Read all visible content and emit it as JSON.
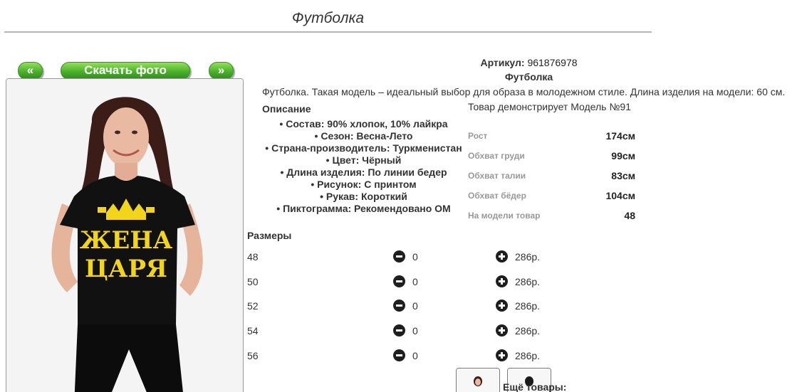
{
  "page": {
    "title": "Футболка"
  },
  "gallery": {
    "prev_label": "«",
    "download_label": "Скачать фото",
    "next_label": "»",
    "print_text_line1": "ЖЕНА",
    "print_text_line2": "ЦАРЯ"
  },
  "product": {
    "article_label": "Артикул:",
    "article_value": "961876978",
    "name": "Футболка",
    "description": "Футболка. Такая модель – идеальный выбор для образа в молодежном стиле. Длина изделия на модели: 60 см."
  },
  "details": {
    "heading": "Описание",
    "items": [
      "Состав: 90% хлопок, 10% лайкра",
      "Сезон: Весна-Лето",
      "Страна-производитель: Туркменистан",
      "Цвет: Чёрный",
      "Длина изделия: По линии бедер",
      "Рисунок: С принтом",
      "Рукав: Короткий",
      "Пиктограмма: Рекомендовано ОМ"
    ]
  },
  "model": {
    "demo_text": "Товар демонстрирует Модель №91",
    "measurements": [
      {
        "label": "Рост",
        "value": "174см"
      },
      {
        "label": "Обхват груди",
        "value": "99см"
      },
      {
        "label": "Обхват талии",
        "value": "83см"
      },
      {
        "label": "Обхват бёдер",
        "value": "104см"
      },
      {
        "label": "На модели товар",
        "value": "48"
      }
    ]
  },
  "sizes": {
    "heading": "Размеры",
    "rows": [
      {
        "size": "48",
        "qty": "0",
        "price": "286р."
      },
      {
        "size": "50",
        "qty": "0",
        "price": "286р."
      },
      {
        "size": "52",
        "qty": "0",
        "price": "286р."
      },
      {
        "size": "54",
        "qty": "0",
        "price": "286р."
      },
      {
        "size": "56",
        "qty": "0",
        "price": "286р."
      }
    ]
  },
  "more": {
    "heading": "Ещё товары:"
  },
  "colors": {
    "button_green": "#4bb02c",
    "shirt": "#111111",
    "print_gold": "#f2d51a"
  }
}
